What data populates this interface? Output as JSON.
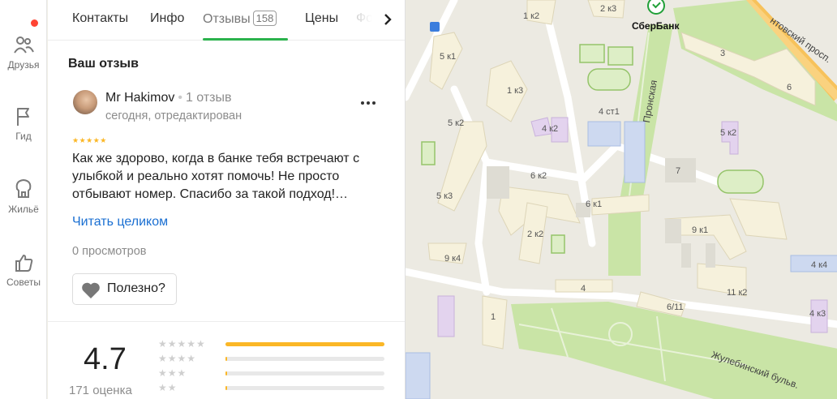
{
  "nav": {
    "top_cut_label": "Друзья",
    "items": [
      {
        "label": "Друзья",
        "icon": "people-icon"
      },
      {
        "label": "Гид",
        "icon": "flag-icon"
      },
      {
        "label": "Жильё",
        "icon": "home-icon"
      },
      {
        "label": "Советы",
        "icon": "thumbs-up-icon"
      }
    ],
    "notification_color": "#f43f2f"
  },
  "tabs": [
    {
      "label": "Контакты"
    },
    {
      "label": "Инфо"
    },
    {
      "label": "Отзывы",
      "count": "158",
      "active": true
    },
    {
      "label": "Цены"
    },
    {
      "label": "Фо"
    }
  ],
  "review_section": {
    "title": "Ваш отзыв",
    "author": "Mr Hakimov",
    "author_reviews": "1 отзыв",
    "date": "сегодня, отредактирован",
    "stars": "★★★★★",
    "rating": 5,
    "text": "Как же здорово, когда в банке тебя встречают с улыбкой и реально хотят помочь! Не просто отбывают номер. Спасибо за такой подход!…",
    "read_more": "Читать целиком",
    "views": "0 просмотров",
    "useful_label": "Полезно?"
  },
  "summary": {
    "rating": "4.7",
    "count": "171 оценка",
    "distribution": [
      {
        "stars": "★★★★★",
        "fraction": 1.0
      },
      {
        "stars": "★★★★",
        "fraction": 0.01
      },
      {
        "stars": "★★★",
        "fraction": 0.01
      },
      {
        "stars": "★★",
        "fraction": 0.01
      }
    ]
  },
  "map": {
    "poi_name": "СберБанк",
    "streets": [
      "Пронская",
      "Жулебинский бульв.",
      "нтовский просп."
    ],
    "buildings": [
      "2 к3",
      "1 к2",
      "3",
      "5 к1",
      "6",
      "1 к3",
      "4 ст1",
      "5 к2",
      "4 к2",
      "5 к2",
      "7",
      "6 к2",
      "5 к3",
      "6 к1",
      "9 к1",
      "2 к2",
      "9 к4",
      "4 к4",
      "1",
      "4",
      "6/11",
      "11 к2",
      "4 к3"
    ],
    "colors": {
      "accent": "#2bb24c",
      "star": "#fbb726",
      "link": "#1a6fd2",
      "sber": "#21a038"
    }
  }
}
